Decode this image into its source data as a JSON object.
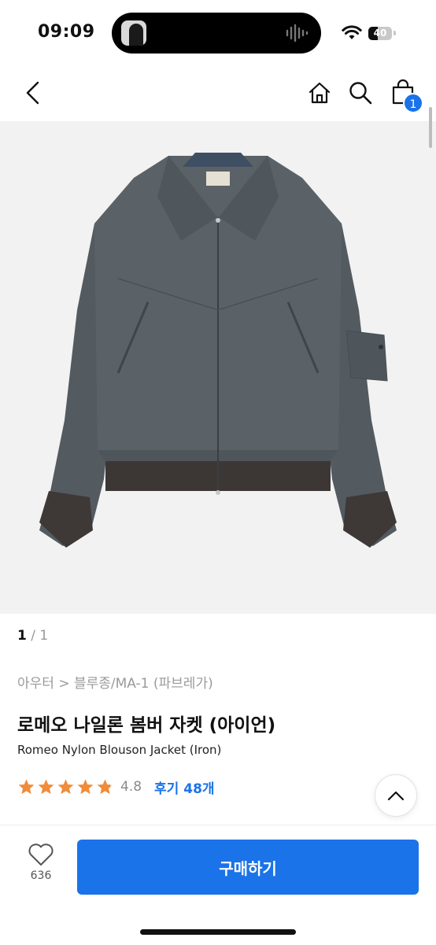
{
  "status_bar": {
    "time": "09:09",
    "battery_level": "40",
    "battery_fraction": 0.4
  },
  "nav": {
    "icons": [
      "back-chevron-icon",
      "home-icon",
      "search-icon",
      "shopping-bag-icon"
    ],
    "cart_count": "1",
    "accent_color": "#1a73e8"
  },
  "gallery": {
    "current": "1",
    "separator": "/",
    "total": "1"
  },
  "product": {
    "breadcrumb": "아우터 > 블루종/MA-1 (파브레가)",
    "title": "로메오 나일론 봄버 자켓 (아이언)",
    "subtitle": "Romeo Nylon Blouson Jacket (Iron)",
    "rating_value": "4.8",
    "rating_fraction": 0.96,
    "review_link": "후기 48개",
    "star_color": "#f08c3a"
  },
  "bottom_bar": {
    "like_count": "636",
    "buy_label": "구매하기"
  }
}
